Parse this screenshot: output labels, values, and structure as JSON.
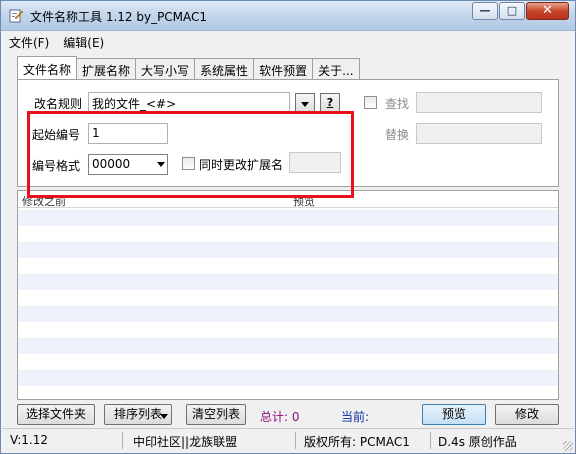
{
  "window": {
    "title": "文件名称工具 1.12  by_PCMAC1",
    "min_glyph": "—",
    "max_glyph": "□",
    "close_glyph": "✕"
  },
  "menu": [
    {
      "label": "文件(F)"
    },
    {
      "label": "编辑(E)"
    }
  ],
  "tabs": [
    {
      "label": "文件名称",
      "active": true
    },
    {
      "label": "扩展名称"
    },
    {
      "label": "大写小写"
    },
    {
      "label": "系统属性"
    },
    {
      "label": "软件预置"
    },
    {
      "label": "关于..."
    }
  ],
  "panel": {
    "rule_label": "改名规则",
    "rule_value": "我的文件_<#>",
    "help_button": "?",
    "find_label": "查找",
    "replace_label": "替换",
    "start_label": "起始编号",
    "start_value": "1",
    "format_label": "编号格式",
    "format_value": "00000",
    "sync_ext_label": "同时更改扩展名"
  },
  "list": {
    "columns": [
      "修改之前",
      "预览"
    ],
    "row_count": 12
  },
  "actions": {
    "select_files": "选择文件夹",
    "sort_list": "排序列表",
    "clear_list": "清空列表",
    "total": "总计: 0",
    "current": "当前:",
    "preview": "预览",
    "modify": "修改"
  },
  "status": {
    "version": "V:1.12",
    "community": "中印社区||龙族联盟",
    "copyright": "版权所有: PCMAC1",
    "credit": "D.4s 原创作品"
  },
  "colors": {
    "highlight_box": "#e8101a",
    "title_bar": "#bfd3ea"
  }
}
